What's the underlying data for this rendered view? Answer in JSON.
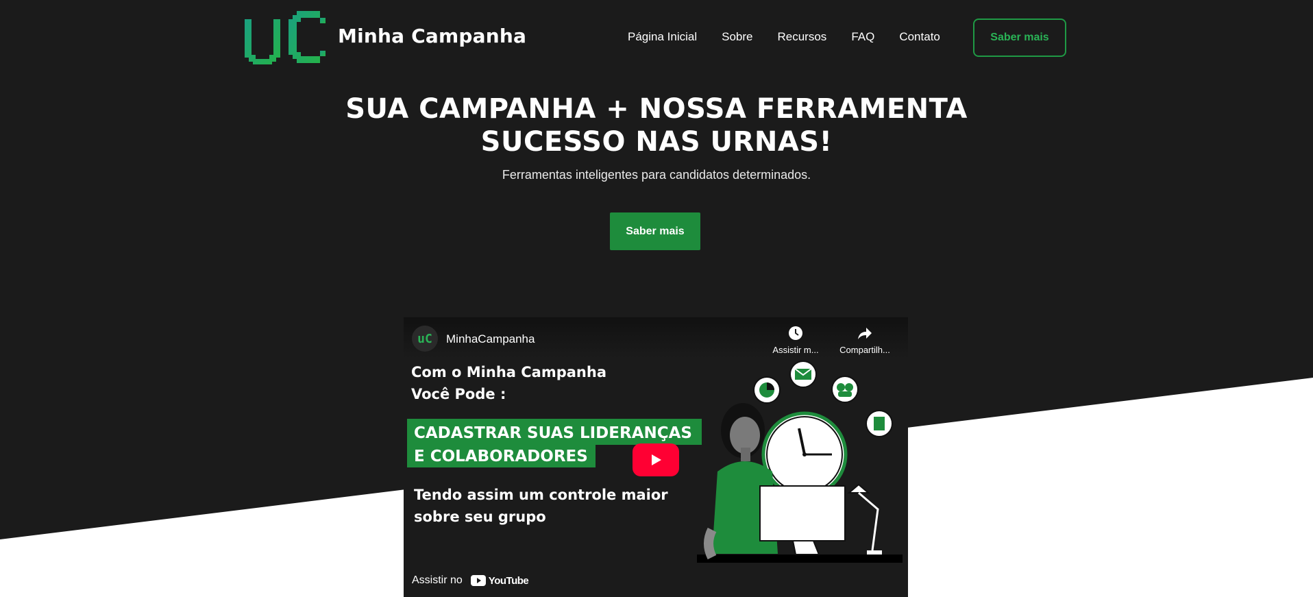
{
  "header": {
    "brand": "Minha Campanha",
    "nav": [
      "Página Inicial",
      "Sobre",
      "Recursos",
      "FAQ",
      "Contato"
    ],
    "cta": "Saber mais"
  },
  "hero": {
    "title_line1": "SUA CAMPANHA + NOSSA FERRAMENTA",
    "title_line2": "SUCESSO NAS URNAS!",
    "subtitle": "Ferramentas inteligentes para candidatos determinados.",
    "cta": "Saber mais"
  },
  "video": {
    "channel_avatar": "uC",
    "channel": "MinhaCampanha",
    "watch_later": "Assistir m...",
    "share": "Compartilh...",
    "heading_line1": "Com o Minha Campanha",
    "heading_line2": "Você Pode :",
    "band_line1": "CADASTRAR SUAS LIDERANÇAS",
    "band_line2": "E COLABORADORES",
    "sub_line1": "Tendo assim um controle maior",
    "sub_line2": "sobre seu grupo",
    "watch_on": "Assistir no",
    "youtube": "YouTube"
  },
  "colors": {
    "accent": "#1e8c3c",
    "accent_light": "#2ab356",
    "background": "#1b1b1b",
    "youtube_red": "#ff0033"
  },
  "icons": [
    "logo-uc",
    "play-icon",
    "clock-icon",
    "share-icon",
    "youtube-icon"
  ]
}
